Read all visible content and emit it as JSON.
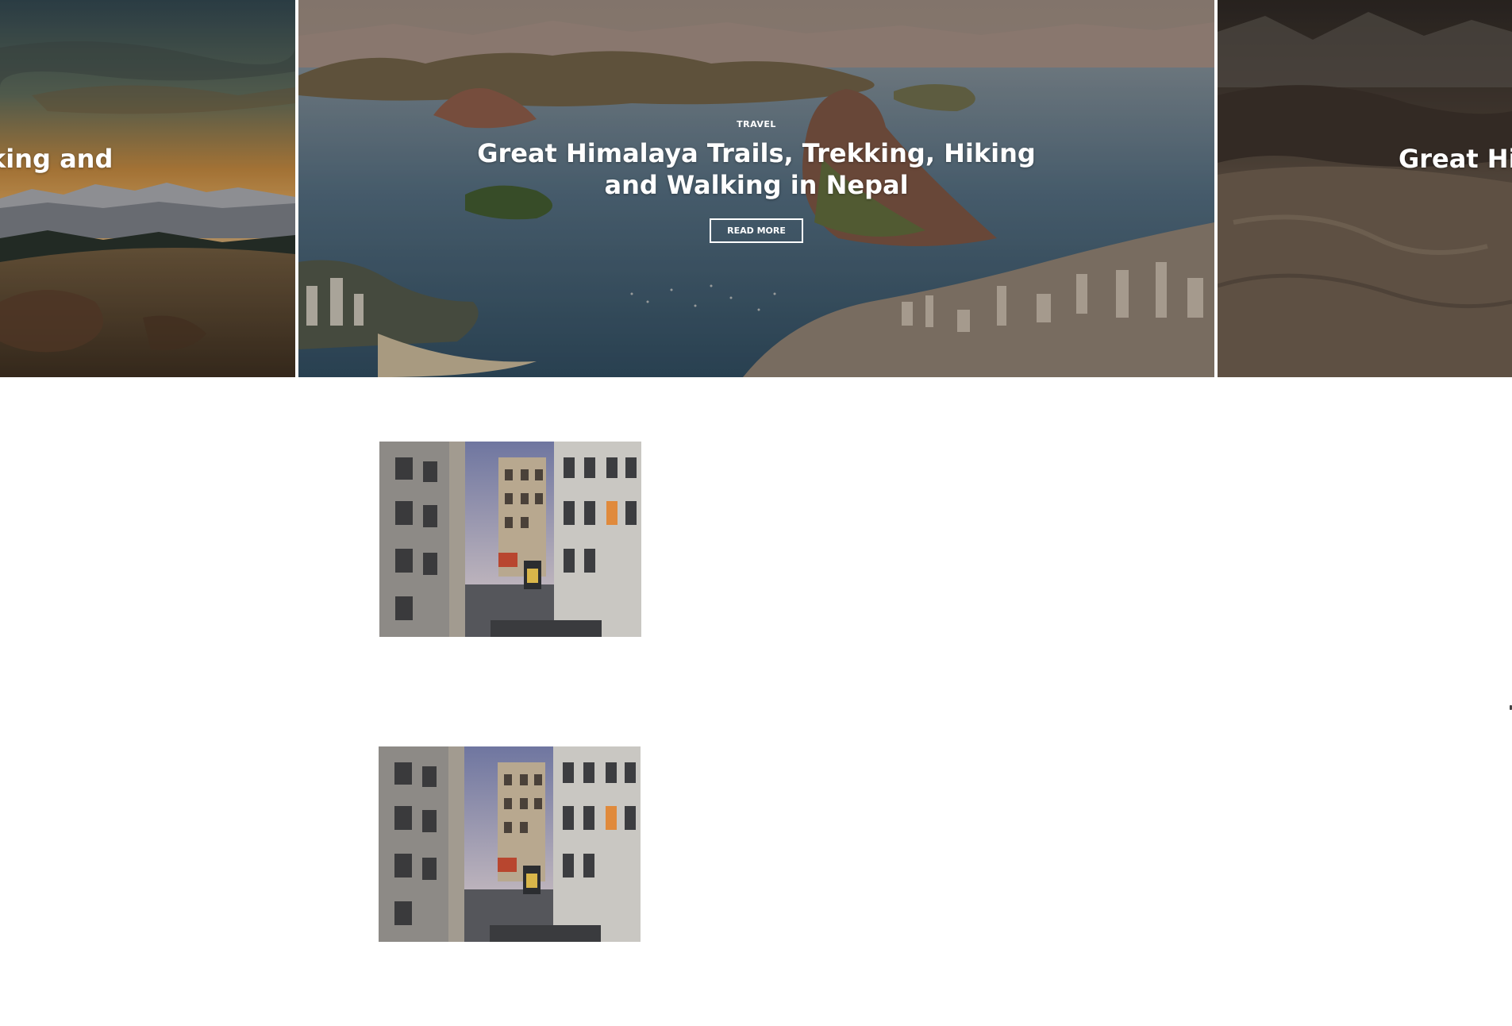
{
  "slider": {
    "prev": {
      "title_fragment": "king and"
    },
    "active": {
      "category": "TRAVEL",
      "title": "Great Himalaya Trails, Trekking, Hiking and Walking in Nepal",
      "read_more": "READ MORE"
    },
    "next": {
      "title_fragment": "Great Hir"
    }
  },
  "posts": [
    {
      "image": "paris-street-metropolitain-photo"
    },
    {
      "image": "paris-street-metropolitain-photo"
    }
  ],
  "colors": {
    "text_on_image": "#ffffff",
    "page_background": "#ffffff"
  }
}
